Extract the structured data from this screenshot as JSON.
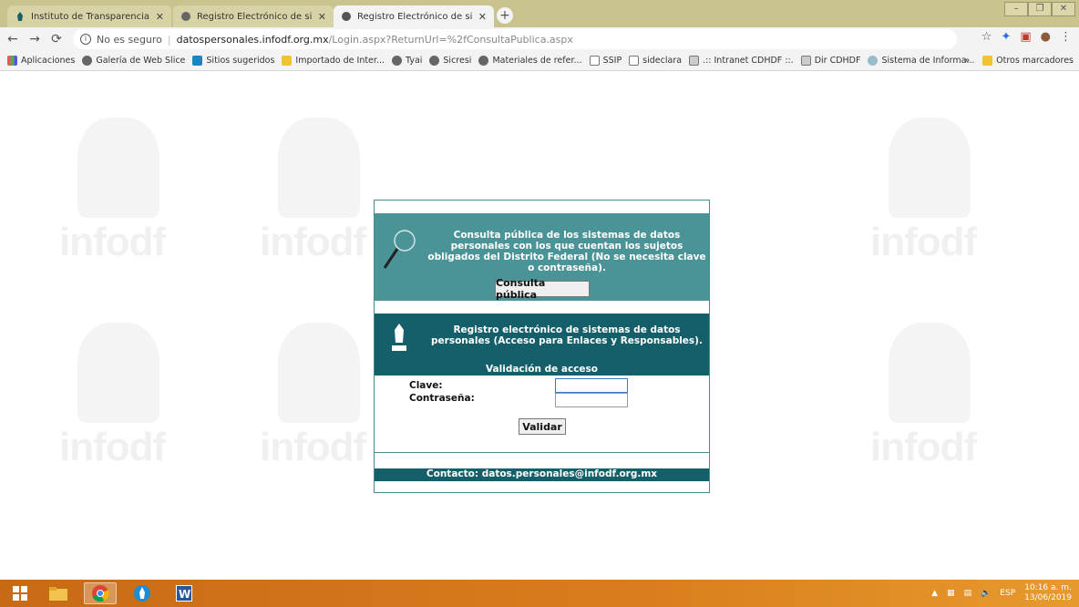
{
  "browser": {
    "tabs": [
      {
        "title": "Instituto de Transparencia, Acces",
        "active": false,
        "icon": "infodf-icon"
      },
      {
        "title": "Registro Electrónico de sistemas",
        "active": false,
        "icon": "globe-icon"
      },
      {
        "title": "Registro Electrónico de sistemas",
        "active": true,
        "icon": "globe-icon"
      }
    ],
    "address": {
      "security_text": "No es seguro",
      "host": "datospersonales.infodf.org.mx",
      "path": "/Login.aspx?ReturnUrl=%2fConsultaPublica.aspx"
    },
    "bookmarks": [
      {
        "label": "Aplicaciones",
        "icon": "grid"
      },
      {
        "label": "Galería de Web Slice",
        "icon": "globe"
      },
      {
        "label": "Sitios sugeridos",
        "icon": "bing"
      },
      {
        "label": "Importado de Inter...",
        "icon": "folder"
      },
      {
        "label": "Tyai",
        "icon": "globe"
      },
      {
        "label": "Sicresi",
        "icon": "globe"
      },
      {
        "label": "Materiales de refer...",
        "icon": "globe"
      },
      {
        "label": "SSIP",
        "icon": "chart"
      },
      {
        "label": "sideclara",
        "icon": "chart"
      },
      {
        "label": ".:: Intranet CDHDF ::.",
        "icon": "net"
      },
      {
        "label": "Dir CDHDF",
        "icon": "net"
      },
      {
        "label": "Sistema de Informa...",
        "icon": "wave"
      }
    ],
    "bookmarks_more": "»",
    "other_bookmarks": "Otros marcadores"
  },
  "page": {
    "watermark_text": "infodf",
    "public_query_text": "Consulta pública de los sistemas de datos personales con los que cuentan los sujetos obligados del Distrito Federal (No se necesita clave o contraseña).",
    "public_query_button": "Consulta pública",
    "registry_text": "Registro electrónico de sistemas de datos personales (Acceso para Enlaces y Responsables).",
    "validation_title": "Validación de acceso",
    "clave_label": "Clave:",
    "password_label": "Contraseña:",
    "validate_button": "Validar",
    "contact_text": "Contacto: datos.personales@infodf.org.mx"
  },
  "taskbar": {
    "language": "ESP",
    "time": "10:16 a. m.",
    "date": "13/06/2019"
  },
  "colors": {
    "teal": "#4a9396",
    "dark_teal": "#155f6a",
    "tab_strip": "#c9c38d"
  }
}
